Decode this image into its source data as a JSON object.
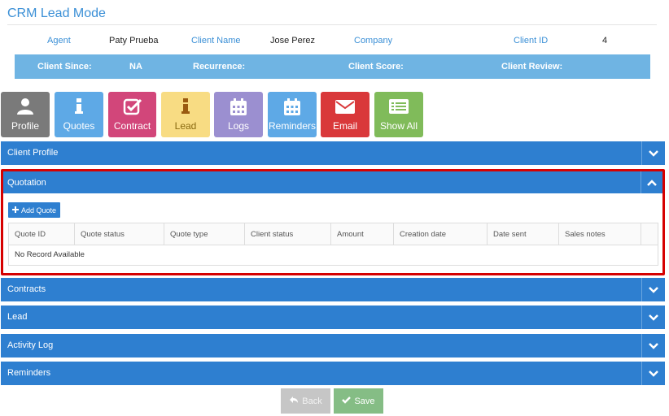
{
  "title": "CRM Lead Mode",
  "info": {
    "agent_label": "Agent",
    "agent_value": "Paty Prueba",
    "client_name_label": "Client Name",
    "client_name_value": "Jose Perez",
    "company_label": "Company",
    "client_id_label": "Client ID",
    "client_id_value": "4",
    "client_since_label": "Client Since:",
    "client_since_value": "NA",
    "recurrence_label": "Recurrence:",
    "client_score_label": "Client Score:",
    "client_review_label": "Client Review:"
  },
  "toolbar": [
    {
      "label": "Profile",
      "icon": "user-icon",
      "color": "#7a7a7a"
    },
    {
      "label": "Quotes",
      "icon": "info-icon",
      "color": "#5ea9e6"
    },
    {
      "label": "Contract",
      "icon": "check-square-icon",
      "color": "#d2467a"
    },
    {
      "label": "Lead",
      "icon": "info-icon",
      "color": "#f8dc83"
    },
    {
      "label": "Logs",
      "icon": "calendar-icon",
      "color": "#9b8fd0"
    },
    {
      "label": "Reminders",
      "icon": "calendar-icon",
      "color": "#5ea9e6"
    },
    {
      "label": "Email",
      "icon": "envelope-icon",
      "color": "#d9383a"
    },
    {
      "label": "Show All",
      "icon": "list-icon",
      "color": "#80bb5a"
    }
  ],
  "panels": {
    "client_profile": "Client Profile",
    "quotation": "Quotation",
    "contracts": "Contracts",
    "lead": "Lead",
    "activity_log": "Activity Log",
    "reminders": "Reminders"
  },
  "quotation": {
    "add_button": "Add Quote",
    "columns": [
      "Quote ID",
      "Quote status",
      "Quote type",
      "Client status",
      "Amount",
      "Creation date",
      "Date sent",
      "Sales notes"
    ],
    "empty_text": "No Record Available"
  },
  "footer": {
    "back_label": "Back",
    "save_label": "Save"
  }
}
